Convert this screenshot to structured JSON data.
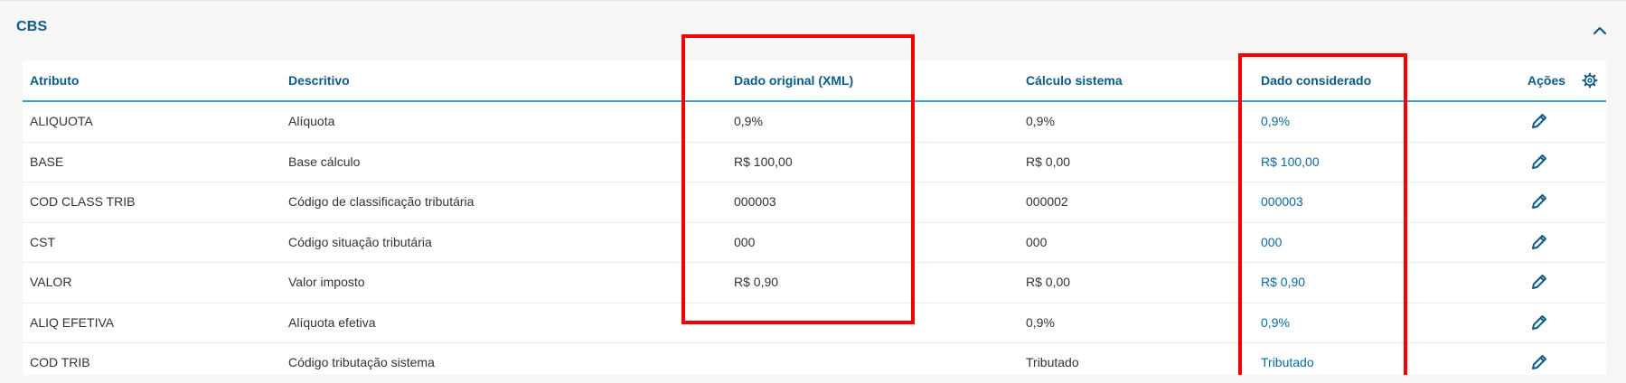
{
  "section": {
    "title": "CBS",
    "collapse_icon": "chevron-up-icon"
  },
  "colors": {
    "accent": "#0c5b87",
    "link": "#0c6aa2",
    "header_rule": "#3b9ad6",
    "highlight": "#f40000"
  },
  "table": {
    "headers": {
      "atributo": "Atributo",
      "descritivo": "Descritivo",
      "dado_original": "Dado original (XML)",
      "calculo_sistema": "Cálculo sistema",
      "dado_considerado": "Dado considerado",
      "acoes": "Ações"
    },
    "settings_icon": "gear-icon",
    "edit_icon": "pencil-icon",
    "rows": [
      {
        "atributo": "ALIQUOTA",
        "descritivo": "Alíquota",
        "dado_original": "0,9%",
        "calculo_sistema": "0,9%",
        "dado_considerado": "0,9%"
      },
      {
        "atributo": "BASE",
        "descritivo": "Base cálculo",
        "dado_original": "R$ 100,00",
        "calculo_sistema": "R$ 0,00",
        "dado_considerado": "R$ 100,00"
      },
      {
        "atributo": "COD CLASS TRIB",
        "descritivo": "Código de classificação tributária",
        "dado_original": "000003",
        "calculo_sistema": "000002",
        "dado_considerado": "000003"
      },
      {
        "atributo": "CST",
        "descritivo": "Código situação tributária",
        "dado_original": "000",
        "calculo_sistema": "000",
        "dado_considerado": "000"
      },
      {
        "atributo": "VALOR",
        "descritivo": "Valor imposto",
        "dado_original": "R$ 0,90",
        "calculo_sistema": "R$ 0,00",
        "dado_considerado": "R$ 0,90"
      },
      {
        "atributo": "ALIQ EFETIVA",
        "descritivo": "Alíquota efetiva",
        "dado_original": "",
        "calculo_sistema": "0,9%",
        "dado_considerado": "0,9%"
      },
      {
        "atributo": "COD TRIB",
        "descritivo": "Código tributação sistema",
        "dado_original": "",
        "calculo_sistema": "Tributado",
        "dado_considerado": "Tributado"
      }
    ]
  }
}
